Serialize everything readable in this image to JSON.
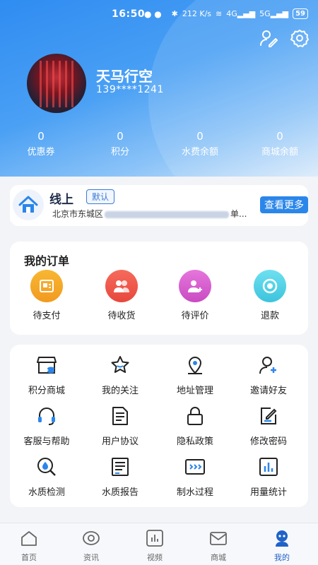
{
  "status_bar": {
    "time": "16:50",
    "network_speed": "212 K/s",
    "battery": "59"
  },
  "profile": {
    "name": "天马行空",
    "phone": "139****1241"
  },
  "stats": [
    {
      "value": "0",
      "label": "优惠券"
    },
    {
      "value": "0",
      "label": "积分"
    },
    {
      "value": "0",
      "label": "水费余额"
    },
    {
      "value": "0",
      "label": "商城余额"
    }
  ],
  "address": {
    "title": "线上",
    "tag": "默认",
    "line_prefix": "北京市东城区",
    "line_suffix": "单...",
    "more_label": "查看更多"
  },
  "orders": {
    "title": "我的订单",
    "items": [
      {
        "label": "待支付",
        "icon": "wallet-icon",
        "color": "#f5a623"
      },
      {
        "label": "待收货",
        "icon": "people-icon",
        "color": "#f0584b"
      },
      {
        "label": "待评价",
        "icon": "person-add-icon",
        "color": "#d85ad0"
      },
      {
        "label": "退款",
        "icon": "refund-icon",
        "color": "#4fd0e6"
      }
    ]
  },
  "services": {
    "items": [
      {
        "label": "积分商城",
        "icon": "store-icon"
      },
      {
        "label": "我的关注",
        "icon": "star-icon"
      },
      {
        "label": "地址管理",
        "icon": "location-icon"
      },
      {
        "label": "邀请好友",
        "icon": "invite-friend-icon"
      },
      {
        "label": "客服与帮助",
        "icon": "headset-icon"
      },
      {
        "label": "用户协议",
        "icon": "document-icon"
      },
      {
        "label": "隐私政策",
        "icon": "lock-icon"
      },
      {
        "label": "修改密码",
        "icon": "edit-icon"
      },
      {
        "label": "水质检测",
        "icon": "water-search-icon"
      },
      {
        "label": "水质报告",
        "icon": "report-icon"
      },
      {
        "label": "制水过程",
        "icon": "process-icon"
      },
      {
        "label": "用量统计",
        "icon": "bar-chart-icon"
      }
    ]
  },
  "tabbar": {
    "active_color": "#1f62c9",
    "items": [
      {
        "label": "首页",
        "icon": "home-icon"
      },
      {
        "label": "资讯",
        "icon": "news-icon"
      },
      {
        "label": "视频",
        "icon": "video-icon"
      },
      {
        "label": "商城",
        "icon": "mail-icon"
      },
      {
        "label": "我的",
        "icon": "profile-icon"
      }
    ]
  }
}
